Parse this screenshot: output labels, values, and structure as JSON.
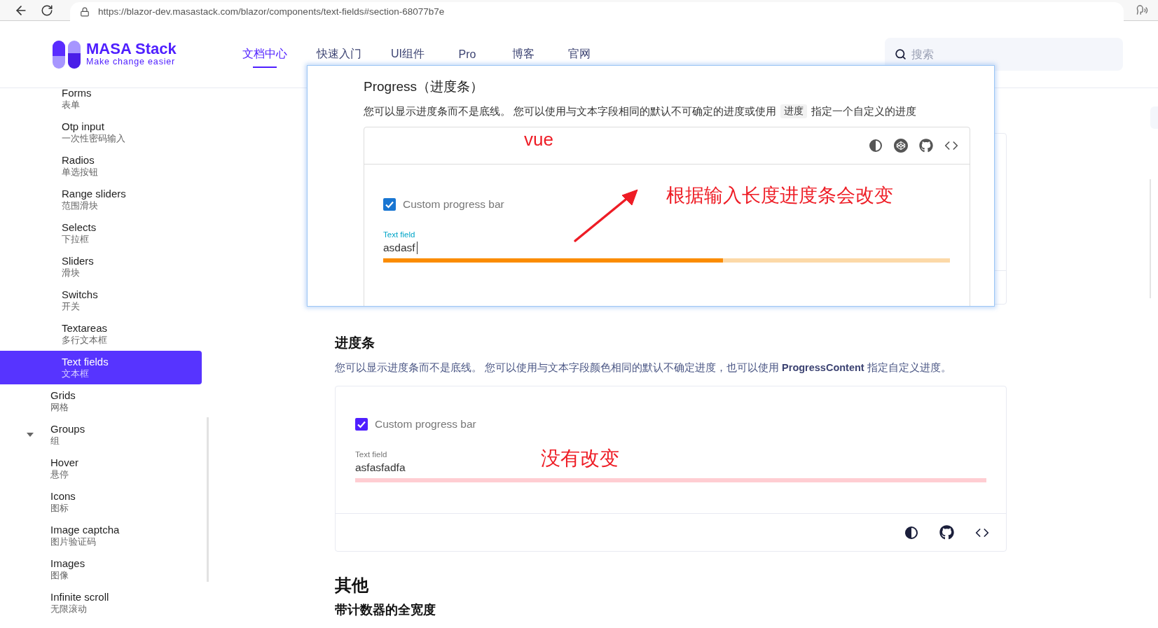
{
  "browser": {
    "url": "https://blazor-dev.masastack.com/blazor/components/text-fields#section-68077b7e"
  },
  "header": {
    "logo": {
      "name": "MASA Stack",
      "tagline": "Make change easier"
    },
    "nav": [
      {
        "label": "文档中心",
        "selected": true
      },
      {
        "label": "快速入门",
        "selected": false
      },
      {
        "label": "UI组件",
        "selected": false
      },
      {
        "label": "Pro",
        "selected": false
      },
      {
        "label": "博客",
        "selected": false
      },
      {
        "label": "官网",
        "selected": false
      }
    ],
    "search": {
      "placeholder": "搜索"
    }
  },
  "sidebar": {
    "sub_items": [
      {
        "title": "Forms",
        "subtitle": "表单",
        "selected": false
      },
      {
        "title": "Otp input",
        "subtitle": "一次性密码输入",
        "selected": false
      },
      {
        "title": "Radios",
        "subtitle": "单选按钮",
        "selected": false
      },
      {
        "title": "Range sliders",
        "subtitle": "范围滑块",
        "selected": false
      },
      {
        "title": "Selects",
        "subtitle": "下拉框",
        "selected": false
      },
      {
        "title": "Sliders",
        "subtitle": "滑块",
        "selected": false
      },
      {
        "title": "Switchs",
        "subtitle": "开关",
        "selected": false
      },
      {
        "title": "Textareas",
        "subtitle": "多行文本框",
        "selected": false
      },
      {
        "title": "Text fields",
        "subtitle": "文本框",
        "selected": true
      }
    ],
    "items": [
      {
        "title": "Grids",
        "subtitle": "网格",
        "expandable": false,
        "selected": false
      },
      {
        "title": "Groups",
        "subtitle": "组",
        "expandable": true,
        "selected": false
      },
      {
        "title": "Hover",
        "subtitle": "悬停",
        "expandable": false,
        "selected": false
      },
      {
        "title": "Icons",
        "subtitle": "图标",
        "expandable": false,
        "selected": false
      },
      {
        "title": "Image captcha",
        "subtitle": "图片验证码",
        "expandable": false,
        "selected": false
      },
      {
        "title": "Images",
        "subtitle": "图像",
        "expandable": false,
        "selected": false
      },
      {
        "title": "Infinite scroll",
        "subtitle": "无限滚动",
        "expandable": false,
        "selected": false
      }
    ]
  },
  "overlay": {
    "title": "Progress（进度条）",
    "description": [
      {
        "kind": "text",
        "text": "您可以显示进度条而不是底线。 您可以使用与文本字段相同的默认不可确定的进度或使用"
      },
      {
        "kind": "code",
        "text": "进度"
      },
      {
        "kind": "text",
        "text": "指定一个自定义的进度"
      }
    ],
    "demo": {
      "annotation": "vue",
      "checkbox": {
        "label": "Custom progress bar",
        "checked": true
      },
      "field": {
        "label": "Text field",
        "value": "asdasf",
        "focused": true
      },
      "progress": {
        "level": 0.6
      },
      "note": "根据输入长度进度条会改变"
    }
  },
  "section": {
    "heading": "进度条",
    "description": "您可以显示进度条而不是底线。 您可以使用与文本字段颜色相同的默认不确定进度，也可以使用 **ProgressContent** 指定自定义进度。",
    "demo": {
      "checkbox": {
        "label": "Custom progress bar",
        "checked": true
      },
      "field": {
        "label": "Text field",
        "value": "asfasfadfa",
        "focused": false
      },
      "progress": {
        "level": 1
      },
      "note": "没有改变"
    }
  },
  "next_section": {
    "heading": "其他",
    "subheading": "带计数器的全宽度"
  }
}
